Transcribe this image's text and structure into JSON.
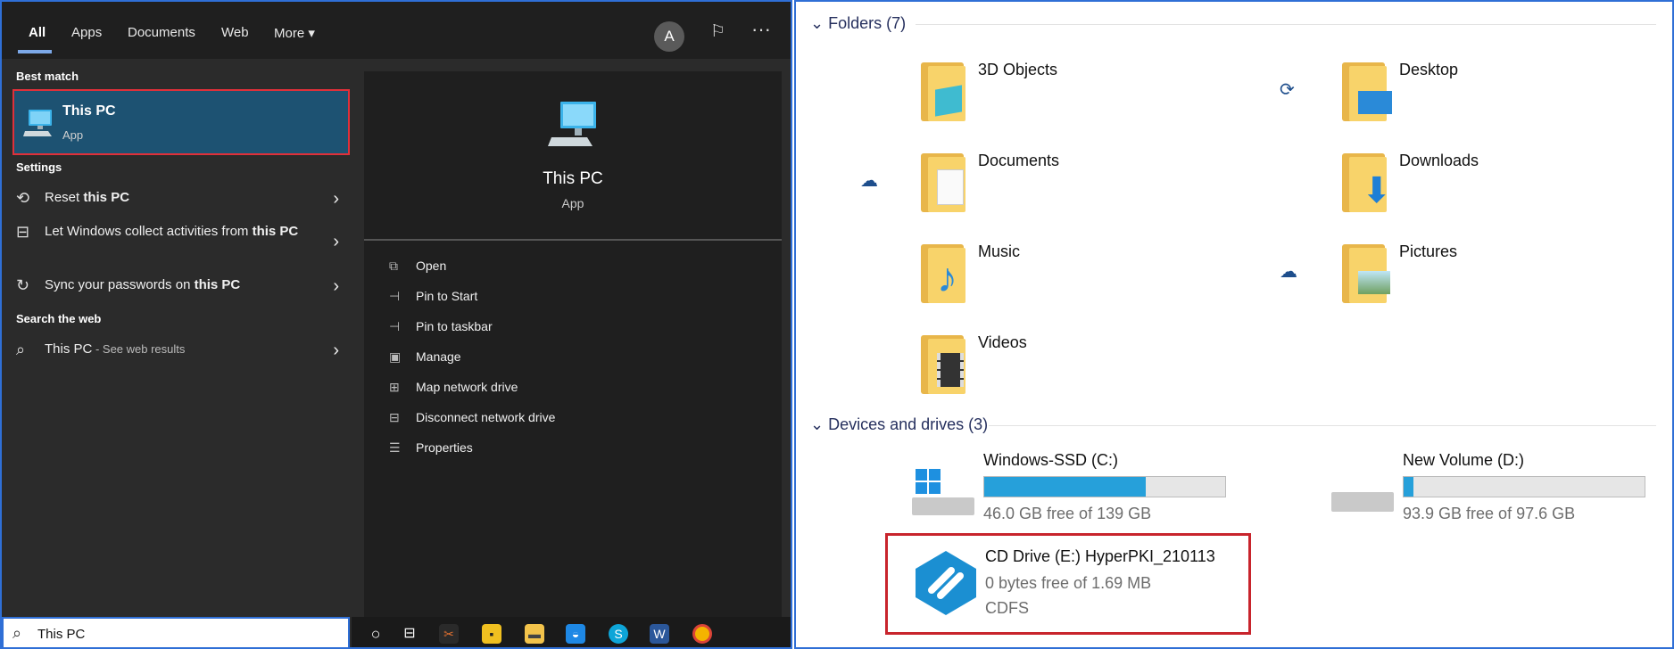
{
  "search_panel": {
    "tabs": [
      "All",
      "Apps",
      "Documents",
      "Web",
      "More"
    ],
    "avatar_letter": "A",
    "sections": {
      "best_match": "Best match",
      "settings": "Settings",
      "search_web": "Search the web"
    },
    "best_match": {
      "title": "This PC",
      "subtitle": "App"
    },
    "settings_items": [
      {
        "pre": "Reset ",
        "bold": "this PC",
        "post": ""
      },
      {
        "pre": "Let Windows collect activities from ",
        "bold": "this PC",
        "post": ""
      },
      {
        "pre": "Sync your passwords on ",
        "bold": "this PC",
        "post": ""
      }
    ],
    "web_result": {
      "main": "This PC",
      "suffix": " - See web results"
    },
    "preview": {
      "title": "This PC",
      "subtitle": "App"
    },
    "actions": [
      "Open",
      "Pin to Start",
      "Pin to taskbar",
      "Manage",
      "Map network drive",
      "Disconnect network drive",
      "Properties"
    ],
    "search_value": "This PC"
  },
  "explorer": {
    "folders_header": "Folders (7)",
    "folders": [
      "3D Objects",
      "Desktop",
      "Documents",
      "Downloads",
      "Music",
      "Pictures",
      "Videos"
    ],
    "drives_header": "Devices and drives (3)",
    "drives": [
      {
        "name": "Windows-SSD (C:)",
        "free": "46.0 GB free of 139 GB",
        "used_fraction": 0.67
      },
      {
        "name": "New Volume (D:)",
        "free": "93.9 GB free of 97.6 GB",
        "used_fraction": 0.04
      },
      {
        "name": "CD Drive (E:) HyperPKI_210113",
        "free": "0 bytes free of 1.69 MB",
        "fs": "CDFS"
      }
    ]
  },
  "colors": {
    "accent": "#26a0da",
    "highlight_border": "#e0303a",
    "best_match_bg": "#1d5272"
  }
}
